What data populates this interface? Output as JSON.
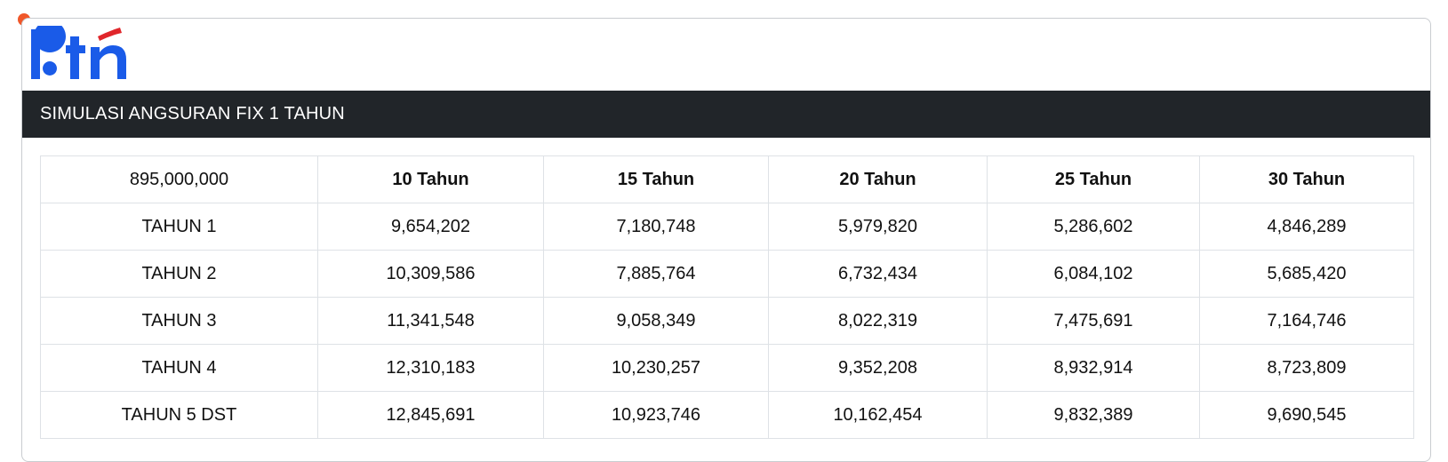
{
  "brand": {
    "logo_text": "btn",
    "logo_blue": "#1a5be8",
    "logo_red": "#e0262b"
  },
  "header": {
    "title": "SIMULASI ANGSURAN FIX 1 TAHUN"
  },
  "table": {
    "corner": "895,000,000",
    "columns": [
      "10 Tahun",
      "15 Tahun",
      "20 Tahun",
      "25 Tahun",
      "30 Tahun"
    ],
    "rows": [
      {
        "label": "TAHUN 1",
        "values": [
          "9,654,202",
          "7,180,748",
          "5,979,820",
          "5,286,602",
          "4,846,289"
        ]
      },
      {
        "label": "TAHUN 2",
        "values": [
          "10,309,586",
          "7,885,764",
          "6,732,434",
          "6,084,102",
          "5,685,420"
        ]
      },
      {
        "label": "TAHUN 3",
        "values": [
          "11,341,548",
          "9,058,349",
          "8,022,319",
          "7,475,691",
          "7,164,746"
        ]
      },
      {
        "label": "TAHUN 4",
        "values": [
          "12,310,183",
          "10,230,257",
          "9,352,208",
          "8,932,914",
          "8,723,809"
        ]
      },
      {
        "label": "TAHUN 5 DST",
        "values": [
          "12,845,691",
          "10,923,746",
          "10,162,454",
          "9,832,389",
          "9,690,545"
        ]
      }
    ]
  },
  "colors": {
    "header_bg": "#212529",
    "accent_dot": "#f0572a",
    "border": "#dee2e6"
  }
}
